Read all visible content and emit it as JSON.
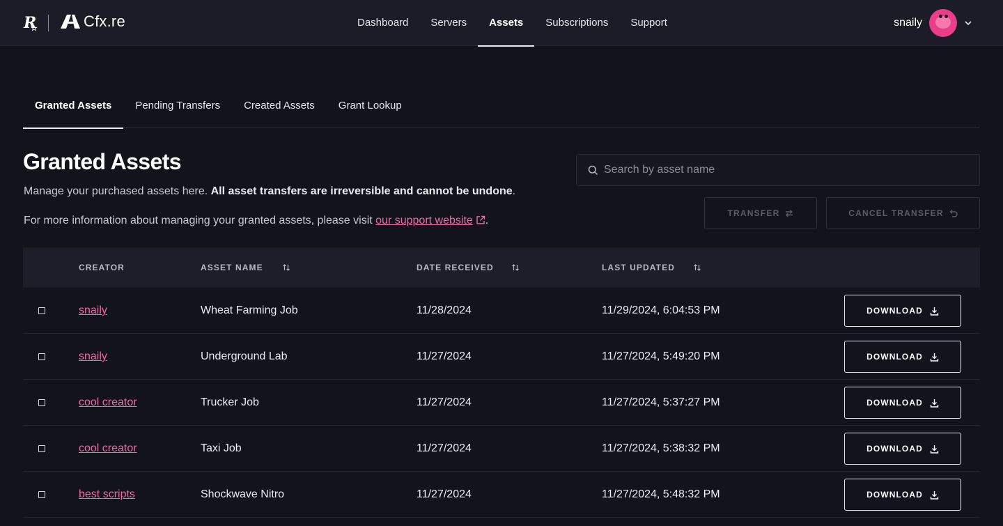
{
  "brand": {
    "rockstar_mark": "R",
    "cfx_name": "Cfx.re"
  },
  "nav": {
    "items": [
      {
        "label": "Dashboard",
        "active": false
      },
      {
        "label": "Servers",
        "active": false
      },
      {
        "label": "Assets",
        "active": true
      },
      {
        "label": "Subscriptions",
        "active": false
      },
      {
        "label": "Support",
        "active": false
      }
    ]
  },
  "user": {
    "name": "snaily"
  },
  "subtabs": [
    {
      "label": "Granted Assets",
      "active": true
    },
    {
      "label": "Pending Transfers",
      "active": false
    },
    {
      "label": "Created Assets",
      "active": false
    },
    {
      "label": "Grant Lookup",
      "active": false
    }
  ],
  "page": {
    "title": "Granted Assets",
    "desc_prefix": "Manage your purchased assets here. ",
    "desc_bold": "All asset transfers are irreversible and cannot be undone",
    "desc_suffix": ".",
    "info_prefix": "For more information about managing your granted assets, please visit ",
    "info_link": "our support website",
    "info_suffix": "."
  },
  "search": {
    "placeholder": "Search by asset name",
    "value": ""
  },
  "actions": {
    "transfer_label": "TRANSFER",
    "cancel_label": "CANCEL TRANSFER"
  },
  "table": {
    "headers": {
      "creator": "CREATOR",
      "asset_name": "ASSET NAME",
      "date_received": "DATE RECEIVED",
      "last_updated": "LAST UPDATED"
    },
    "download_label": "DOWNLOAD",
    "rows": [
      {
        "creator": "snaily",
        "asset": "Wheat Farming Job",
        "date": "11/28/2024",
        "updated": "11/29/2024, 6:04:53 PM"
      },
      {
        "creator": "snaily",
        "asset": "Underground Lab",
        "date": "11/27/2024",
        "updated": "11/27/2024, 5:49:20 PM"
      },
      {
        "creator": "cool creator",
        "asset": "Trucker Job",
        "date": "11/27/2024",
        "updated": "11/27/2024, 5:37:27 PM"
      },
      {
        "creator": "cool creator",
        "asset": "Taxi Job",
        "date": "11/27/2024",
        "updated": "11/27/2024, 5:38:32 PM"
      },
      {
        "creator": "best scripts",
        "asset": "Shockwave Nitro",
        "date": "11/27/2024",
        "updated": "11/27/2024, 5:48:32 PM"
      }
    ]
  },
  "colors": {
    "background": "#12131b",
    "topbar": "#1b1c27",
    "accent_link": "#f06aa6",
    "table_header": "#1d1e2a"
  },
  "icons": [
    "rockstar-logo",
    "cfx-logo",
    "chevron-down-icon",
    "search-icon",
    "swap-icon",
    "undo-icon",
    "external-link-icon",
    "sort-icon",
    "download-icon"
  ]
}
